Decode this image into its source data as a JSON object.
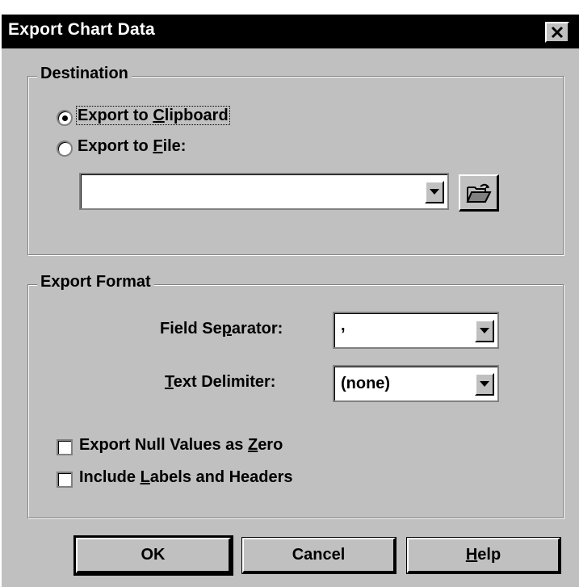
{
  "dialog": {
    "title": "Export Chart Data"
  },
  "destination": {
    "legend": "Destination",
    "options": [
      {
        "pre": "Export to ",
        "key": "C",
        "post": "lipboard",
        "selected": true
      },
      {
        "pre": "Export to ",
        "key": "F",
        "post": "ile:",
        "selected": false
      }
    ],
    "file_path": ""
  },
  "format": {
    "legend": "Export Format",
    "field_separator": {
      "pre": "Field Se",
      "key": "p",
      "post": "arator:",
      "value": ","
    },
    "text_delimiter": {
      "pre": "",
      "key": "T",
      "post": "ext Delimiter:",
      "value": "(none)"
    },
    "checkboxes": [
      {
        "pre": "Export Null Values as ",
        "key": "Z",
        "post": "ero",
        "checked": false
      },
      {
        "pre": "Include ",
        "key": "L",
        "post": "abels and Headers",
        "checked": false
      }
    ]
  },
  "buttons": {
    "ok": "OK",
    "cancel": "Cancel",
    "help": {
      "pre": "",
      "key": "H",
      "post": "elp"
    }
  },
  "colors": {
    "face": "#c0c0c0",
    "titlebar": "#000000",
    "title_text": "#ffffff"
  },
  "icons": {
    "close": "close-x-icon",
    "dropdown": "down-triangle-icon",
    "browse": "open-folder-icon"
  }
}
